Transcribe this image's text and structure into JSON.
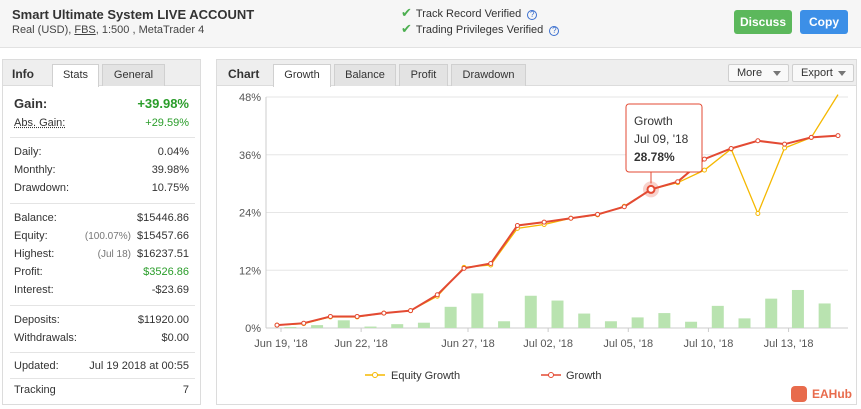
{
  "header": {
    "title": "Smart Ultimate System LIVE ACCOUNT",
    "account_type": "Real (USD),",
    "broker": "FBS",
    "leverage_platform": ", 1:500 , MetaTrader 4",
    "verified": [
      "Track Record Verified",
      "Trading Privileges Verified"
    ],
    "discuss_label": "Discuss",
    "copy_label": "Copy",
    "check_color": "#4caf50",
    "discuss_color": "#5cb85c",
    "copy_color": "#3c8fe7"
  },
  "left_panel": {
    "section_label": "Info",
    "tabs": [
      "Stats",
      "General"
    ],
    "active_tab": "Stats",
    "gain_label": "Gain:",
    "gain_value": "+39.98%",
    "abs_gain_label": "Abs. Gain:",
    "abs_gain_value": "+29.59%",
    "daily_label": "Daily:",
    "daily_value": "0.04%",
    "monthly_label": "Monthly:",
    "monthly_value": "39.98%",
    "drawdown_label": "Drawdown:",
    "drawdown_value": "10.75%",
    "balance_label": "Balance:",
    "balance_value": "$15446.86",
    "equity_label": "Equity:",
    "equity_note": "(100.07%)",
    "equity_value": "$15457.66",
    "highest_label": "Highest:",
    "highest_note": "(Jul 18)",
    "highest_value": "$16237.51",
    "profit_label": "Profit:",
    "profit_value": "$3526.86",
    "interest_label": "Interest:",
    "interest_value": "-$23.69",
    "deposits_label": "Deposits:",
    "deposits_value": "$11920.00",
    "withdrawals_label": "Withdrawals:",
    "withdrawals_value": "$0.00",
    "updated_label": "Updated:",
    "updated_value": "Jul 19 2018 at 00:55",
    "tracking_label": "Tracking",
    "tracking_value": "7"
  },
  "chart_panel": {
    "section_label": "Chart",
    "tabs": [
      "Growth",
      "Balance",
      "Profit",
      "Drawdown"
    ],
    "active_tab": "Growth",
    "more_label": "More",
    "export_label": "Export"
  },
  "tooltip": {
    "series": "Growth",
    "date": "Jul 09, '18",
    "value": "28.78%"
  },
  "watermark": "EAHub",
  "chart_data": {
    "type": "line",
    "x_ticks": [
      "Jun 19, '18",
      "Jun 22, '18",
      "Jun 27, '18",
      "Jul 02, '18",
      "Jul 05, '18",
      "Jul 10, '18",
      "Jul 13, '18"
    ],
    "y_ticks": [
      "0%",
      "12%",
      "24%",
      "36%",
      "48%"
    ],
    "ylim": [
      0,
      48
    ],
    "grid": true,
    "legend": "bottom",
    "series": [
      {
        "name": "Equity Growth",
        "color": "#f5b800",
        "values": [
          0.6,
          0.9,
          2.3,
          2.3,
          3.1,
          3.6,
          6.6,
          12.6,
          13.1,
          20.7,
          21.5,
          22.8,
          23.5,
          25.3,
          28.8,
          30.2,
          32.8,
          37.2,
          23.8,
          37.4,
          39.6,
          48.5
        ]
      },
      {
        "name": "Growth",
        "color": "#e34a33",
        "values": [
          0.6,
          1.0,
          2.4,
          2.4,
          3.1,
          3.6,
          6.9,
          12.4,
          13.4,
          21.3,
          22.0,
          22.8,
          23.6,
          25.2,
          28.8,
          30.4,
          35.1,
          37.3,
          38.9,
          38.2,
          39.6,
          39.98
        ]
      },
      {
        "name": "Daily gain",
        "color": "#b9e3b0",
        "values": [
          0.2,
          0.6,
          1.6,
          0.3,
          0.8,
          1.1,
          4.4,
          7.2,
          1.4,
          6.7,
          5.7,
          3.0,
          1.4,
          2.2,
          3.1,
          1.3,
          4.6,
          2.0,
          6.1,
          7.9,
          5.1
        ]
      }
    ]
  }
}
